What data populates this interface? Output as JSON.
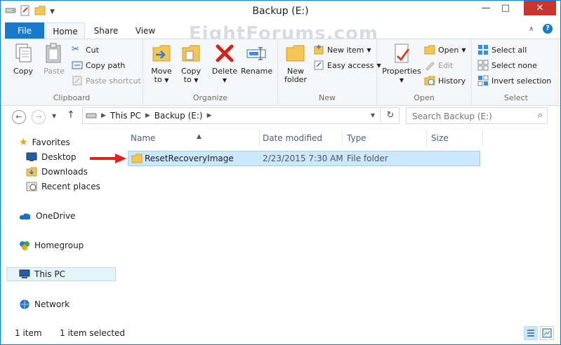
{
  "window": {
    "title": "Backup (E:)",
    "controls": {
      "minimize": "—",
      "maximize": "□",
      "close": "✕"
    }
  },
  "watermark": "EightForums.com",
  "ribbon_tabs": [
    {
      "label": "File"
    },
    {
      "label": "Home"
    },
    {
      "label": "Share"
    },
    {
      "label": "View"
    }
  ],
  "ribbon": {
    "clipboard": {
      "label": "Clipboard",
      "copy": "Copy",
      "paste": "Paste",
      "cut": "Cut",
      "copy_path": "Copy path",
      "paste_shortcut": "Paste shortcut"
    },
    "organize": {
      "label": "Organize",
      "move_to": "Move",
      "move_to_2": "to",
      "copy_to": "Copy",
      "copy_to_2": "to",
      "delete": "Delete",
      "rename": "Rename"
    },
    "new": {
      "label": "New",
      "new_folder": "New",
      "new_folder_2": "folder",
      "new_item": "New item",
      "easy_access": "Easy access"
    },
    "open": {
      "label": "Open",
      "properties": "Properties",
      "open": "Open",
      "edit": "Edit",
      "history": "History"
    },
    "select": {
      "label": "Select",
      "select_all": "Select all",
      "select_none": "Select none",
      "invert_selection": "Invert selection"
    }
  },
  "address": {
    "crumbs": [
      "This PC",
      "Backup (E:)"
    ],
    "search_placeholder": "Search Backup (E:)"
  },
  "nav_pane": {
    "favorites": "Favorites",
    "desktop": "Desktop",
    "downloads": "Downloads",
    "recent_places": "Recent places",
    "onedrive": "OneDrive",
    "homegroup": "Homegroup",
    "this_pc": "This PC",
    "network": "Network"
  },
  "columns": {
    "name": "Name",
    "date_modified": "Date modified",
    "type": "Type",
    "size": "Size"
  },
  "files": [
    {
      "name": "ResetRecoveryImage",
      "date_modified": "2/23/2015 7:30 AM",
      "type": "File folder",
      "size": ""
    }
  ],
  "status": {
    "item_count": "1 item",
    "selected": "1 item selected"
  },
  "colors": {
    "accent": "#1979ca",
    "close_button": "#c7372f",
    "selection_fill": "#cce8ff",
    "annotation_arrow": "#e2201c"
  }
}
